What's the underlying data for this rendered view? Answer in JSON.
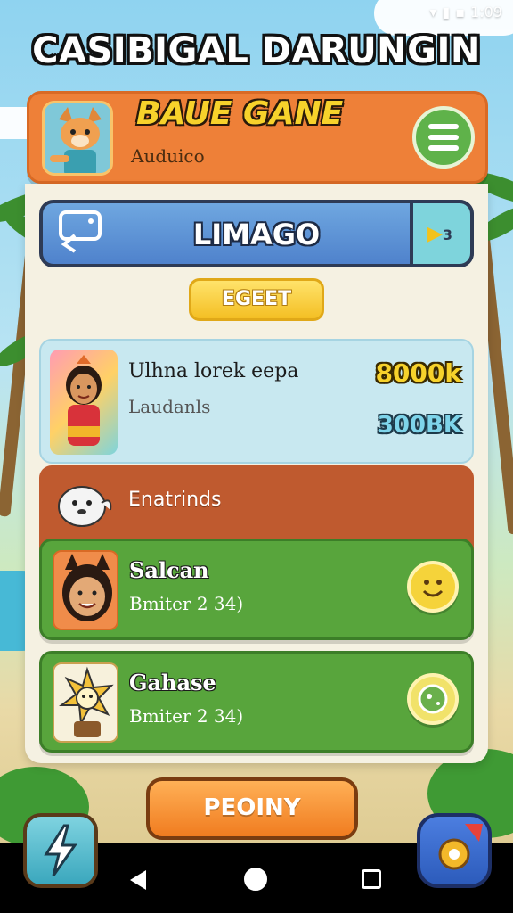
{
  "status_bar": {
    "time": "1:09"
  },
  "game": {
    "title": "CASIBIGAL DARUNGIN",
    "subtitle": "BAUE GANE"
  },
  "header": {
    "username": "Auduico",
    "menu_icon": "hamburger-icon"
  },
  "level": {
    "label": "LIMAGO"
  },
  "select_button": {
    "label": "EGEET"
  },
  "featured": {
    "title": "Ulhna lorek eepa",
    "subtitle": "Laudanls",
    "value_primary": "8000k",
    "value_secondary": "300BK"
  },
  "section": {
    "label": "Enatrinds"
  },
  "players": [
    {
      "name": "Salcan",
      "meta": "Bmiter 2 34)"
    },
    {
      "name": "Gahase",
      "meta": "Bmiter 2 34)"
    }
  ],
  "play_button": {
    "label": "PEOINY"
  },
  "colors": {
    "header": "#ee8038",
    "level_bar": "#5a8fd6",
    "green_card": "#58a53c",
    "brown_card": "#bf5a2f",
    "play": "#f28a2a"
  }
}
